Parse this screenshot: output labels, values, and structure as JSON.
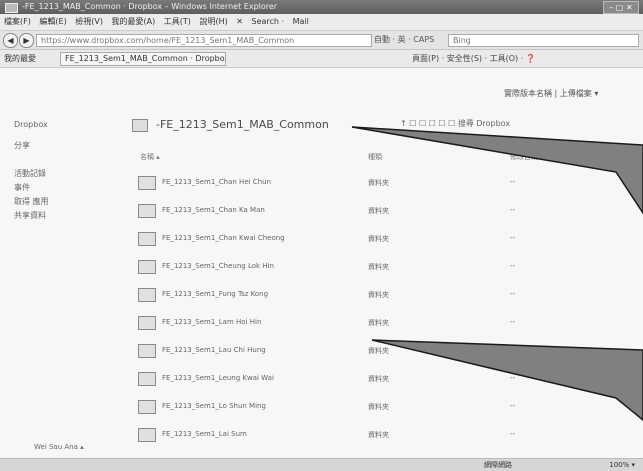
{
  "window": {
    "title": "-FE_1213_MAB_Common · Dropbox – Windows Internet Explorer"
  },
  "menu": {
    "items": [
      "檔案(F)",
      "編輯(E)",
      "檢視(V)",
      "我的最愛(A)",
      "工具(T)",
      "說明(H)",
      "✕",
      "Search ·",
      "Mail"
    ]
  },
  "address": {
    "url": "https://www.dropbox.com/home/FE_1213_Sem1_MAB_Common",
    "middle": "自動 · 英 · CAPS",
    "search": "Bing"
  },
  "favorites": {
    "label": "我的最愛",
    "tab": "FE_1213_Sem1_MAB_Common · Dropbox",
    "tools": "頁面(P) · 安全性(S) · 工具(O) · ❓"
  },
  "top_right": "實際版本名稱 | 上傳檔案 ▾",
  "sidebar": {
    "items": [
      "Dropbox",
      "分享",
      "活動記錄",
      "事件",
      "取得 應用",
      "共享資料"
    ]
  },
  "folder": {
    "title": "-FE_1213_Sem1_MAB_Common",
    "tools": "↑ ☐ ☐ ☐ ☐ ☐  搜尋 Dropbox"
  },
  "columns": {
    "name": "名稱 ▴",
    "kind": "種類",
    "modified": "修改日期"
  },
  "rows": [
    {
      "name": "FE_1213_Sem1_Chan Hei Chun",
      "kind": "資料夾",
      "mod": "--"
    },
    {
      "name": "FE_1213_Sem1_Chan Ka Man",
      "kind": "資料夾",
      "mod": "--"
    },
    {
      "name": "FE_1213_Sem1_Chan Kwai Cheong",
      "kind": "資料夾",
      "mod": "--"
    },
    {
      "name": "FE_1213_Sem1_Cheung Lok Hin",
      "kind": "資料夾",
      "mod": "--"
    },
    {
      "name": "FE_1213_Sem1_Fung Tsz Kong",
      "kind": "資料夾",
      "mod": "--"
    },
    {
      "name": "FE_1213_Sem1_Lam Hoi Hin",
      "kind": "資料夾",
      "mod": "--"
    },
    {
      "name": "FE_1213_Sem1_Lau Chi Hung",
      "kind": "資料夾",
      "mod": "--"
    },
    {
      "name": "FE_1213_Sem1_Leung Kwai Wai",
      "kind": "資料夾",
      "mod": "--"
    },
    {
      "name": "FE_1213_Sem1_Lo Shun Ming",
      "kind": "資料夾",
      "mod": "--"
    },
    {
      "name": "FE_1213_Sem1_Lai Sum",
      "kind": "資料夾",
      "mod": "--"
    }
  ],
  "bottom": {
    "signin": "Wei Sau Ana ▴",
    "status_left": "網際網路",
    "status_right": "100% ▾"
  }
}
